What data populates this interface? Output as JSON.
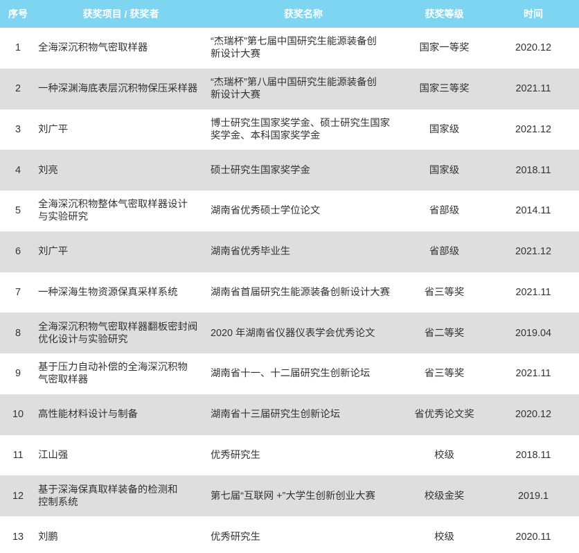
{
  "colors": {
    "header_bg": "#7dd5f1",
    "header_text": "#ffffff",
    "stripe_bg": "#dedede",
    "body_text": "#333333"
  },
  "header": {
    "no": "序号",
    "project": "获奖项目 / 获奖者",
    "award": "获奖名称",
    "level": "获奖等级",
    "time": "时间"
  },
  "rows": [
    {
      "no": "1",
      "project": "全海深沉积物气密取样器",
      "award": "“杰瑞杯”第七届中国研究生能源装备创\n新设计大赛",
      "level": "国家一等奖",
      "time": "2020.12"
    },
    {
      "no": "2",
      "project": "一种深渊海底表层沉积物保压采样器",
      "award": "“杰瑞杯”第八届中国研究生能源装备创\n新设计大赛",
      "level": "国家三等奖",
      "time": "2021.11"
    },
    {
      "no": "3",
      "project": "刘广平",
      "award": "博士研究生国家奖学金、硕士研究生国家\n奖学金、本科国家奖学金",
      "level": "国家级",
      "time": "2021.12"
    },
    {
      "no": "4",
      "project": "刘亮",
      "award": "硕士研究生国家奖学金",
      "level": "国家级",
      "time": "2018.11"
    },
    {
      "no": "5",
      "project": "全海深沉积物整体气密取样器设计\n与实验研究",
      "award": "湖南省优秀硕士学位论文",
      "level": "省部级",
      "time": "2014.11"
    },
    {
      "no": "6",
      "project": "刘广平",
      "award": "湖南省优秀毕业生",
      "level": "省部级",
      "time": "2021.12"
    },
    {
      "no": "7",
      "project": "一种深海生物资源保真采样系统",
      "award": "湖南省首届研究生能源装备创新设计大赛",
      "level": "省三等奖",
      "time": "2021.11"
    },
    {
      "no": "8",
      "project": "全海深沉积物气密取样器翻板密封阀\n优化设计与实验研究",
      "award": "2020 年湖南省仪器仪表学会优秀论文",
      "level": "省二等奖",
      "time": "2019.04"
    },
    {
      "no": "9",
      "project": "基于压力自动补偿的全海深沉积物\n气密取样器",
      "award": "湖南省十一、十二届研究生创新论坛",
      "level": "省三等奖",
      "time": "2021.11"
    },
    {
      "no": "10",
      "project": "高性能材料设计与制备",
      "award": "湖南省十三届研究生创新论坛",
      "level": "省优秀论文奖",
      "time": "2020.12"
    },
    {
      "no": "11",
      "project": "江山强",
      "award": "优秀研究生",
      "level": "校级",
      "time": "2018.11"
    },
    {
      "no": "12",
      "project": "基于深海保真取样装备的检测和\n控制系统",
      "award": "第七届“互联网 +”大学生创新创业大赛",
      "level": "校级金奖",
      "time": "2019.1"
    },
    {
      "no": "13",
      "project": "刘鹏",
      "award": "优秀研究生",
      "level": "校级",
      "time": "2020.11"
    }
  ]
}
